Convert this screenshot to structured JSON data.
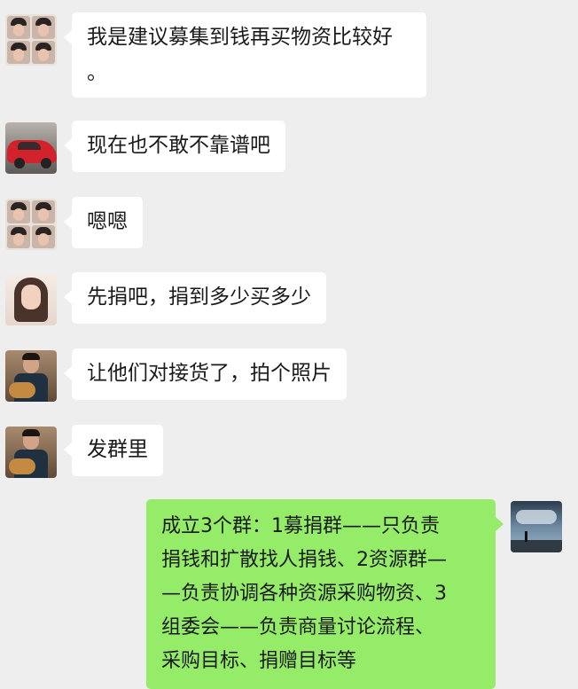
{
  "messages": [
    {
      "side": "left",
      "avatar": "group-avatar",
      "text_lines": [
        "我是建议募集到钱再买物资比较好",
        "。"
      ]
    },
    {
      "side": "left",
      "avatar": "red-car-avatar",
      "text_lines": [
        "现在也不敢不靠谱吧"
      ]
    },
    {
      "side": "left",
      "avatar": "group-avatar",
      "text_lines": [
        "嗯嗯"
      ]
    },
    {
      "side": "left",
      "avatar": "girl-avatar",
      "text_lines": [
        "先捐吧，捐到多少买多少"
      ]
    },
    {
      "side": "left",
      "avatar": "guitar-man-avatar",
      "text_lines": [
        "让他们对接货了，拍个照片"
      ]
    },
    {
      "side": "left",
      "avatar": "guitar-man-avatar",
      "text_lines": [
        "发群里"
      ]
    },
    {
      "side": "right",
      "avatar": "sky-landscape-avatar",
      "text_lines": [
        "成立3个群：1募捐群——只负责",
        "捐钱和扩散找人捐钱、2资源群—",
        "—负责协调各种资源采购物资、3",
        "组委会——负责商量讨论流程、",
        "采购目标、捐赠目标等"
      ]
    }
  ],
  "colors": {
    "background": "#eeeeee",
    "bubble_left": "#ffffff",
    "bubble_right": "#95ec69"
  }
}
